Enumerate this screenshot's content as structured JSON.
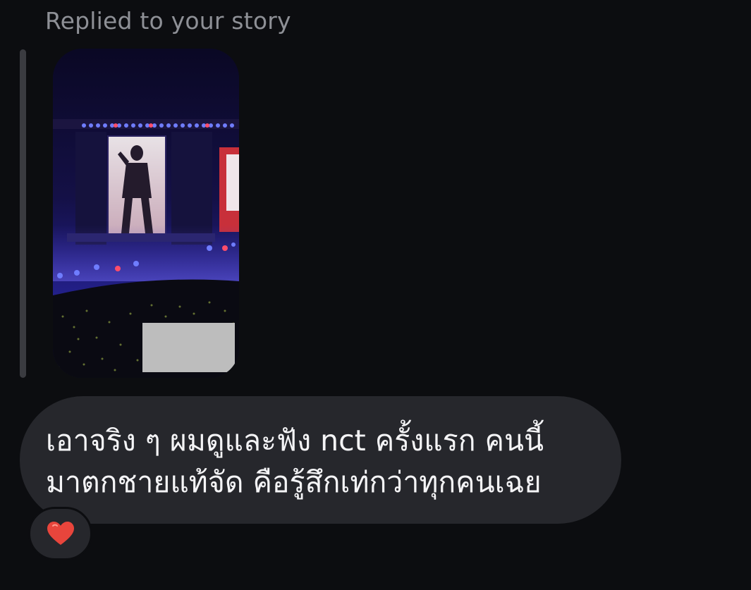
{
  "reply_context": {
    "label": "Replied to your story"
  },
  "story": {
    "thumbnail_icon": "concert-stage-photo",
    "redaction_icon": "gray-redaction-block"
  },
  "message": {
    "lines": [
      "เอาจริง ๆ ผมดูและฟัง nct ครั้งแรก คนนี้",
      "มาตกชายแท้จัด คือรู้สึกเท่กว่าทุกคนเฉย"
    ]
  },
  "reaction": {
    "icon": "red-heart-emoji",
    "color": "#e8453c"
  },
  "colors": {
    "background": "#0c0d10",
    "bubble": "#26272c",
    "text": "#f4f4f6",
    "muted_text": "#8e9096"
  }
}
